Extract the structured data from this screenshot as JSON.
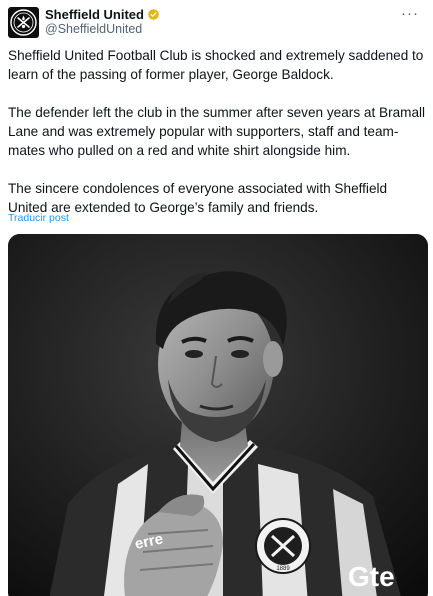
{
  "author": {
    "display_name": "Sheffield United",
    "handle": "@SheffieldUnited",
    "verified_badge": "gold-verified-badge-icon",
    "avatar": "sheffield-united-crest"
  },
  "menu_icon": "more-dots-icon",
  "more_label": "···",
  "post": {
    "paragraphs": [
      "Sheffield United Football Club is shocked and extremely saddened to learn of the passing of former player, George Baldock.",
      "The defender left the club in the summer after seven years at Bramall Lane and was extremely popular with supporters, staff and team-mates who pulled on a red and white shirt alongside him.",
      "The sincere condolences of everyone associated with Sheffield United are extended to George’s family and friends."
    ],
    "translate_link": "Traducir post"
  },
  "media": {
    "type": "photo",
    "kit_texts": [
      "erre",
      "Gte"
    ],
    "crest_text": "1889"
  },
  "colors": {
    "link": "#1d9bf0",
    "text": "#0f1419",
    "secondary": "#536471",
    "badge": "#e2b719"
  }
}
